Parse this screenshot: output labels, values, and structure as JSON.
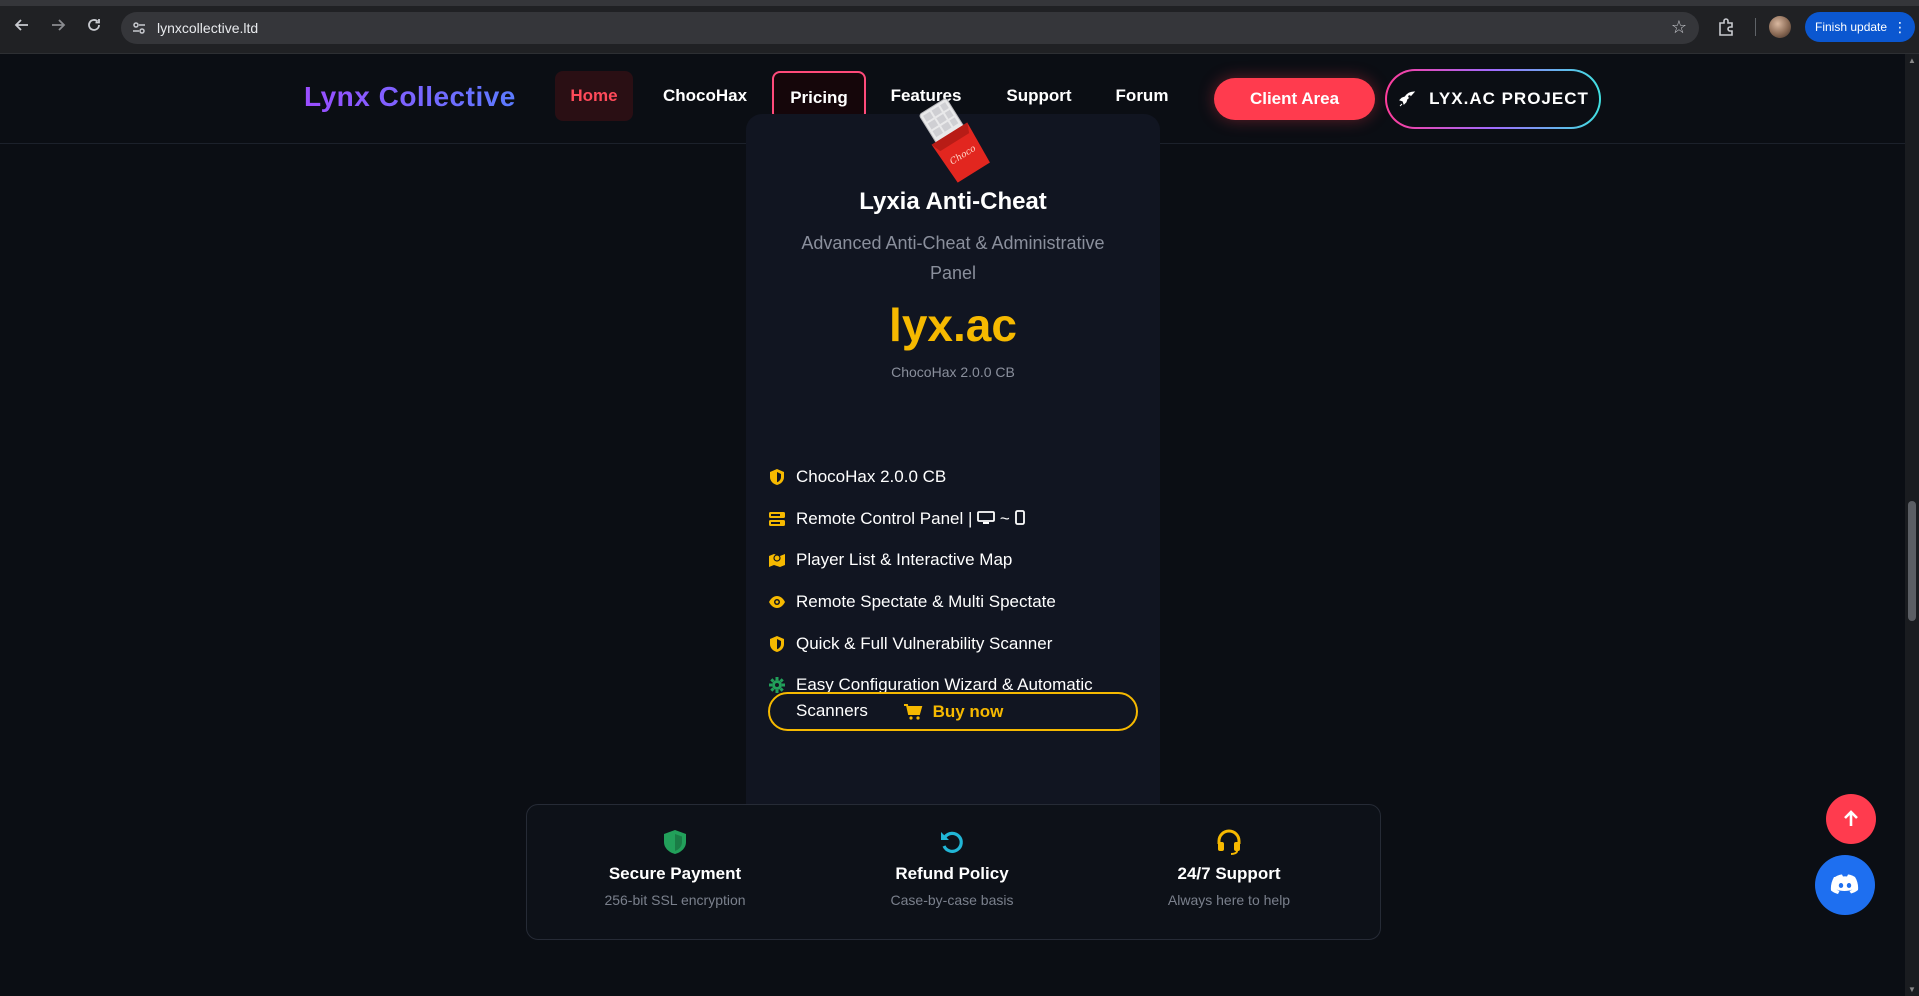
{
  "browser": {
    "url": "lynxcollective.ltd",
    "update_button_label": "Finish update",
    "back_icon": "arrow-left-icon",
    "forward_icon": "arrow-right-icon",
    "reload_icon": "reload-icon",
    "bookmark_icon": "star-icon",
    "extensions_icon": "puzzle-icon"
  },
  "header": {
    "logo": "Lynx Collective",
    "nav": [
      {
        "label": "Home"
      },
      {
        "label": "ChocoHax"
      },
      {
        "label": "Pricing"
      },
      {
        "label": "Features"
      },
      {
        "label": "Support"
      },
      {
        "label": "Forum"
      }
    ],
    "client_area_label": "Client Area",
    "project_label": "LYX.AC PROJECT",
    "active_color": "#ff4a5a"
  },
  "product": {
    "title": "Lyxia Anti-Cheat",
    "subtitle": "Advanced Anti-Cheat & Administrative Panel",
    "price": "lyx.ac",
    "version": "ChocoHax 2.0.0 CB",
    "accent_color": "#f6b900",
    "features": [
      {
        "icon": "shield-icon",
        "text": "ChocoHax 2.0.0 CB"
      },
      {
        "icon": "server-icon",
        "text": "Remote Control Panel |",
        "extra": "~"
      },
      {
        "icon": "map-icon",
        "text": "Player List & Interactive Map"
      },
      {
        "icon": "eye-icon",
        "text": "Remote Spectate & Multi Spectate"
      },
      {
        "icon": "shield-icon",
        "text": "Quick & Full Vulnerability Scanner"
      },
      {
        "icon": "gear-icon",
        "text": "Easy Configuration Wizard & Automatic Scanners"
      }
    ],
    "buy_label": "Buy now"
  },
  "guarantees": [
    {
      "icon": "shield-icon",
      "title": "Secure Payment",
      "subtitle": "256-bit SSL encryption",
      "color": "#22a05a"
    },
    {
      "icon": "undo-icon",
      "title": "Refund Policy",
      "subtitle": "Case-by-case basis",
      "color": "#21b6d6"
    },
    {
      "icon": "headset-icon",
      "title": "24/7 Support",
      "subtitle": "Always here to help",
      "color": "#f6b900"
    }
  ]
}
